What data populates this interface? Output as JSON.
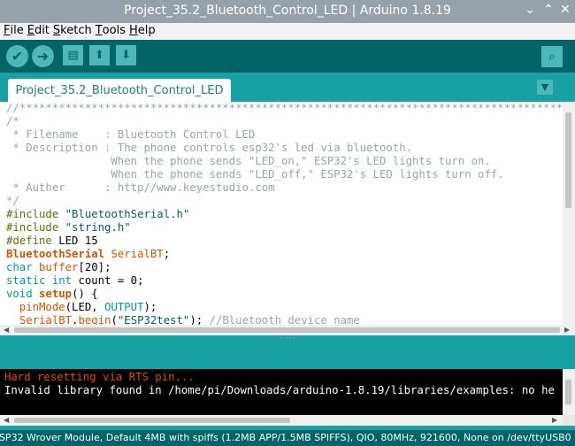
{
  "window": {
    "title": "Project_35.2_Bluetooth_Control_LED | Arduino 1.8.19",
    "controls": [
      "⌄",
      "⌃",
      "✕"
    ]
  },
  "menu": {
    "items": [
      {
        "label": "File",
        "key": "F",
        "rest": "ile"
      },
      {
        "label": "Edit",
        "key": "E",
        "rest": "dit"
      },
      {
        "label": "Sketch",
        "key": "S",
        "rest": "ketch"
      },
      {
        "label": "Tools",
        "key": "T",
        "rest": "ools"
      },
      {
        "label": "Help",
        "key": "H",
        "rest": "elp"
      }
    ]
  },
  "toolbar": {
    "icons": [
      "verify-icon",
      "upload-icon",
      "new-icon",
      "open-icon",
      "save-icon",
      "serial-monitor-icon"
    ],
    "glyphs": {
      "verify": "✔",
      "upload": "➜",
      "new": "▤",
      "open": "⬆",
      "save": "⬇",
      "serial": "⌕"
    }
  },
  "tabs": {
    "active": "Project_35.2_Bluetooth_Control_LED",
    "menu_glyph": "▼"
  },
  "editor": {
    "lines": [
      [
        [
          "cm",
          "//************************************************************************************************"
        ]
      ],
      [
        [
          "cm",
          "/*"
        ]
      ],
      [
        [
          "cm",
          " * Filename    : Bluetooth Control LED"
        ]
      ],
      [
        [
          "cm",
          " * Description : The phone controls esp32's led via bluetooth."
        ]
      ],
      [
        [
          "cm",
          "                When the phone sends \"LED_on,\" ESP32's LED lights turn on."
        ]
      ],
      [
        [
          "cm",
          "                When the phone sends \"LED_off,\" ESP32's LED lights turn off."
        ]
      ],
      [
        [
          "cm",
          " * Auther      : http//"
        ],
        [
          "u",
          "www.keyestudio.com"
        ]
      ],
      [
        [
          "cm",
          "*/"
        ]
      ],
      [
        [
          "pp",
          "#include"
        ],
        [
          "",
          " "
        ],
        [
          "str",
          "\"BluetoothSerial.h\""
        ]
      ],
      [
        [
          "pp",
          "#include"
        ],
        [
          "",
          " "
        ],
        [
          "str",
          "\"string.h\""
        ]
      ],
      [
        [
          "pp",
          "#define"
        ],
        [
          "",
          " LED 15"
        ]
      ],
      [
        [
          "kwb",
          "BluetoothSerial"
        ],
        [
          "",
          " "
        ],
        [
          "kw",
          "SerialBT"
        ],
        [
          "",
          ";"
        ]
      ],
      [
        [
          "ty",
          "char"
        ],
        [
          "",
          " "
        ],
        [
          "kw",
          "buffer"
        ],
        [
          "",
          "[20];"
        ]
      ],
      [
        [
          "ty",
          "static"
        ],
        [
          "",
          " "
        ],
        [
          "ty",
          "int"
        ],
        [
          "",
          " count = 0;"
        ]
      ],
      [
        [
          "ty",
          "void"
        ],
        [
          "",
          " "
        ],
        [
          "kwb",
          "setup"
        ],
        [
          "",
          "() {"
        ]
      ],
      [
        [
          "",
          "  "
        ],
        [
          "kw",
          "pinMode"
        ],
        [
          "",
          "(LED, "
        ],
        [
          "ty",
          "OUTPUT"
        ],
        [
          "",
          ");"
        ]
      ],
      [
        [
          "",
          "  "
        ],
        [
          "kw",
          "SerialBT"
        ],
        [
          "",
          "."
        ],
        [
          "kw",
          "begin"
        ],
        [
          "",
          "("
        ],
        [
          "str",
          "\"ESP32test\""
        ],
        [
          "",
          "); "
        ],
        [
          "cm",
          "//Bluetooth device name"
        ]
      ]
    ]
  },
  "console": {
    "lines": [
      {
        "cls": "c-err",
        "text": "Hard resetting via RTS pin..."
      },
      {
        "cls": "c-out",
        "text": "Invalid library found in /home/pi/Downloads/arduino-1.8.19/libraries/examples: no he"
      }
    ]
  },
  "status": {
    "text": "ESP32 Wrover Module, Default 4MB with spiffs (1.2MB APP/1.5MB SPIFFS), QIO, 80MHz, 921600, None on /dev/ttyUSB0"
  },
  "colors": {
    "toolbar": "#006468",
    "tabbar": "#17a1a5",
    "button": "#4db7bb",
    "comment": "#95a5a6",
    "keyword": "#d35400",
    "error": "#e34c00"
  }
}
